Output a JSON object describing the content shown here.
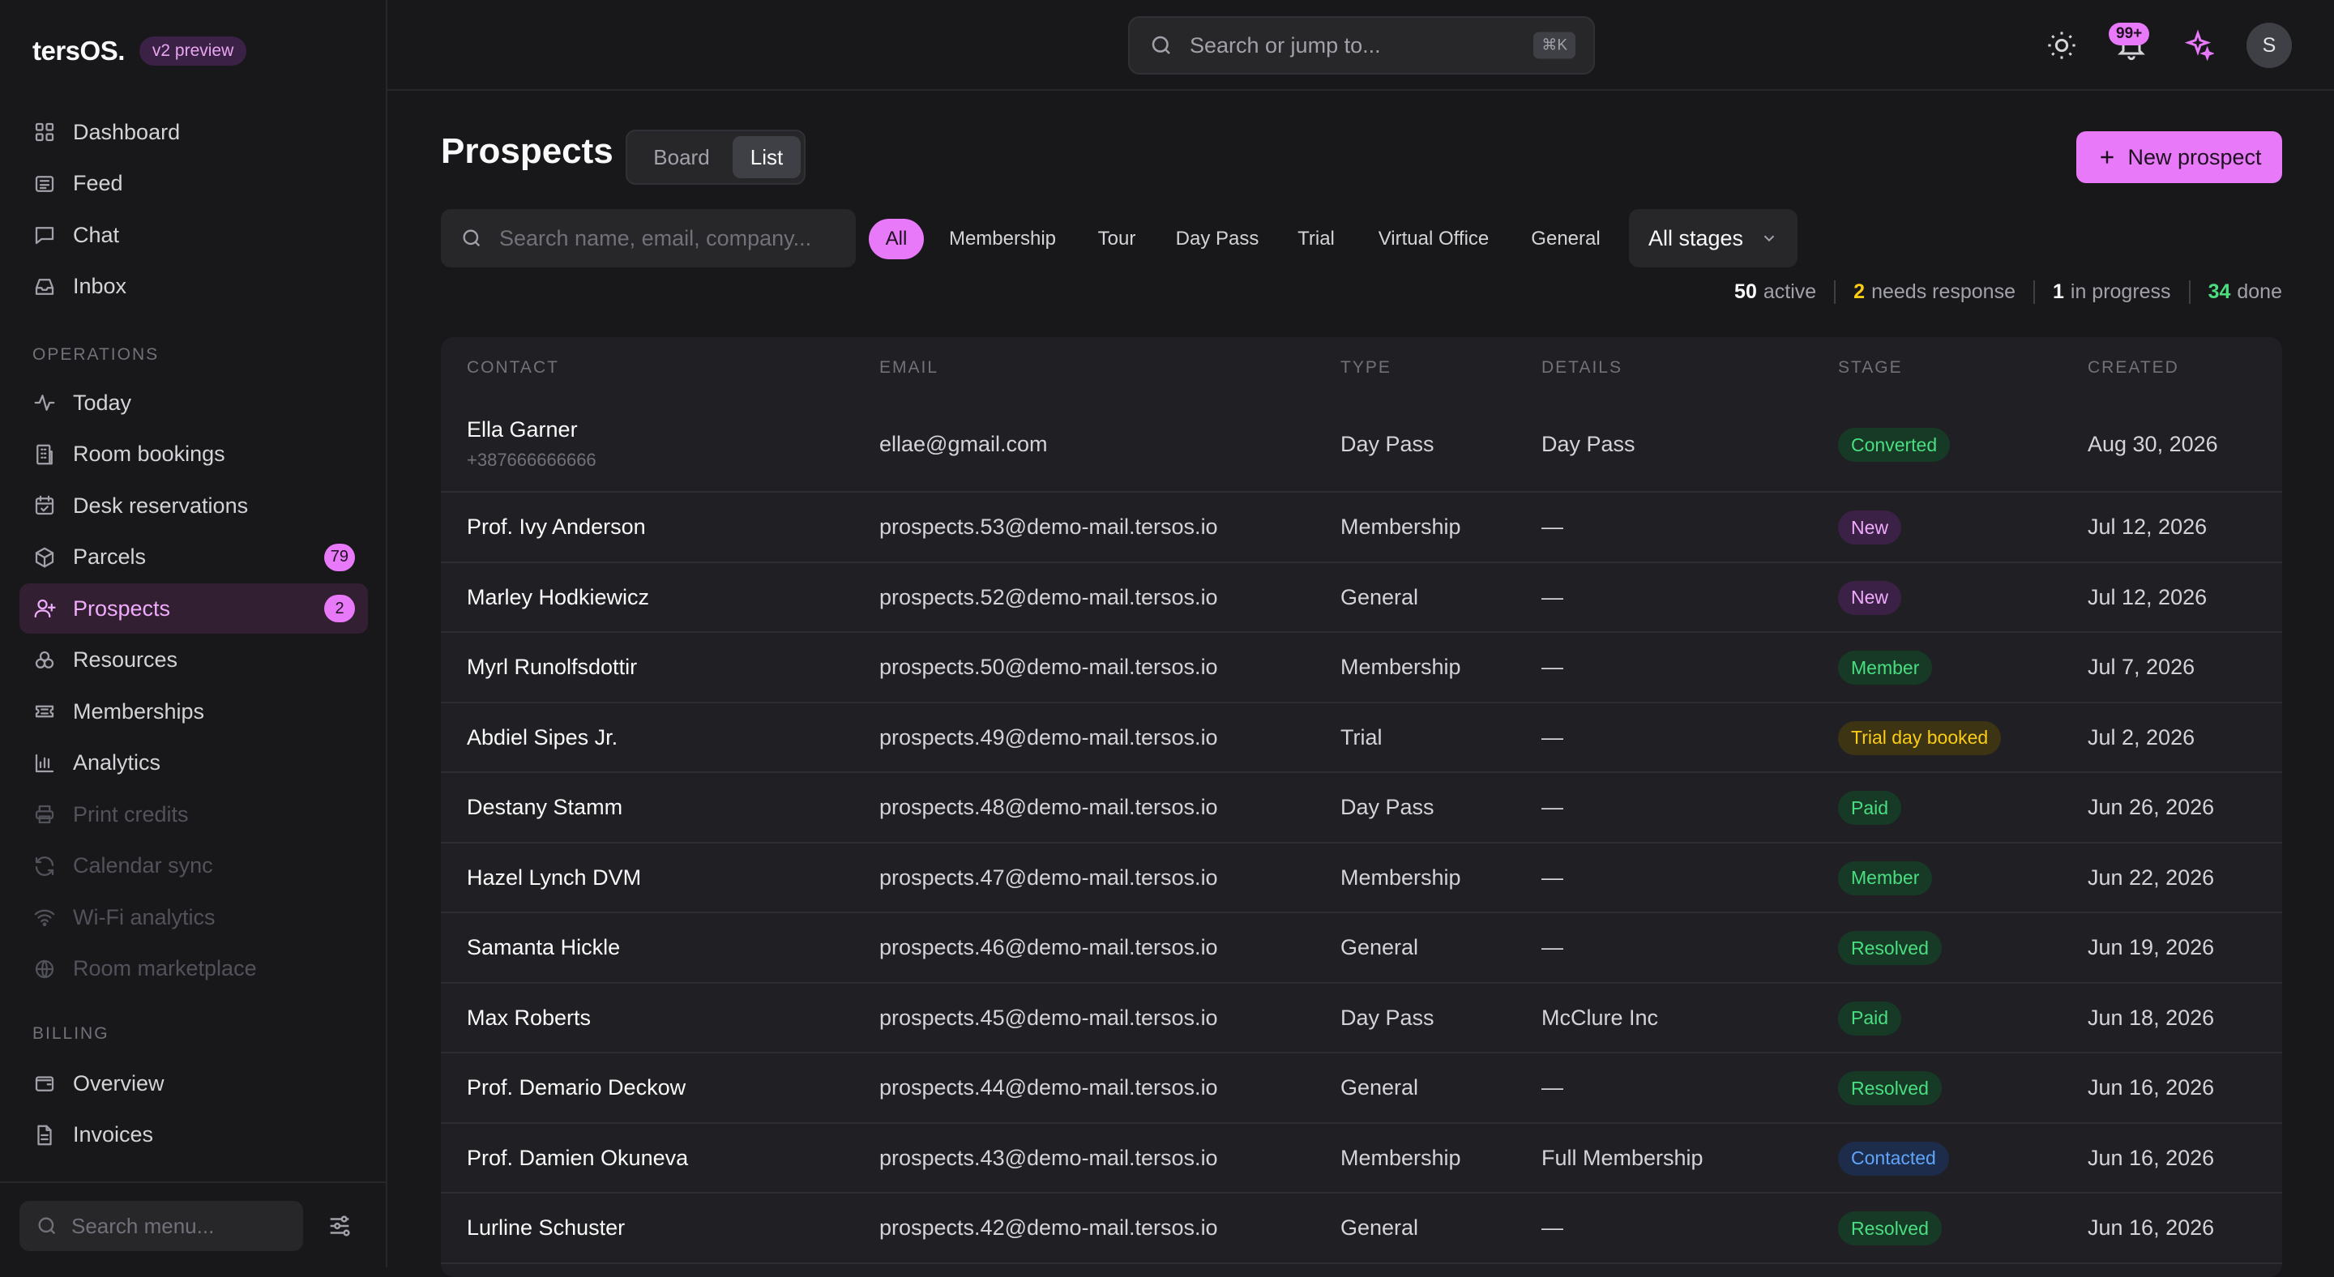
{
  "brand": {
    "name": "tersOS.",
    "badge": "v2 preview"
  },
  "colors": {
    "accent": "#e879f9",
    "background": "#18181b",
    "surface": "#27272a"
  },
  "sidebar": {
    "main": [
      {
        "label": "Dashboard",
        "icon": "grid-icon"
      },
      {
        "label": "Feed",
        "icon": "newspaper-icon"
      },
      {
        "label": "Chat",
        "icon": "chat-icon"
      },
      {
        "label": "Inbox",
        "icon": "inbox-icon"
      }
    ],
    "operations_label": "OPERATIONS",
    "operations": [
      {
        "label": "Today",
        "icon": "activity-icon"
      },
      {
        "label": "Room bookings",
        "icon": "building-icon"
      },
      {
        "label": "Desk reservations",
        "icon": "calendar-icon"
      },
      {
        "label": "Parcels",
        "icon": "package-icon",
        "count": "79"
      },
      {
        "label": "Prospects",
        "icon": "user-plus-icon",
        "count": "2",
        "active": true
      },
      {
        "label": "Resources",
        "icon": "boxes-icon"
      },
      {
        "label": "Memberships",
        "icon": "ticket-icon"
      },
      {
        "label": "Analytics",
        "icon": "bar-chart-icon"
      },
      {
        "label": "Print credits",
        "icon": "printer-icon",
        "disabled": true
      },
      {
        "label": "Calendar sync",
        "icon": "refresh-icon",
        "disabled": true
      },
      {
        "label": "Wi-Fi analytics",
        "icon": "wifi-icon",
        "disabled": true
      },
      {
        "label": "Room marketplace",
        "icon": "globe-icon",
        "disabled": true
      }
    ],
    "billing_label": "BILLING",
    "billing": [
      {
        "label": "Overview",
        "icon": "wallet-icon"
      },
      {
        "label": "Invoices",
        "icon": "file-icon"
      }
    ],
    "menu_search_placeholder": "Search menu..."
  },
  "topbar": {
    "search_placeholder": "Search or jump to...",
    "shortcut": "⌘K",
    "notifications_count": "99+",
    "avatar_initial": "S"
  },
  "page": {
    "title": "Prospects",
    "views": [
      "Board",
      "List"
    ],
    "selected_view": "List",
    "new_button": "New prospect",
    "search_placeholder": "Search name, email, company...",
    "type_filters": [
      "All",
      "Membership",
      "Tour",
      "Day Pass",
      "Trial",
      "Virtual Office",
      "General"
    ],
    "selected_filter": "All",
    "stage_select": "All stages",
    "stats": [
      {
        "value": "50",
        "label": "active",
        "color": "#fafafa"
      },
      {
        "value": "2",
        "label": "needs response",
        "color": "#facc15"
      },
      {
        "value": "1",
        "label": "in progress",
        "color": "#fafafa"
      },
      {
        "value": "34",
        "label": "done",
        "color": "#4ade80"
      }
    ]
  },
  "table": {
    "columns": [
      "CONTACT",
      "EMAIL",
      "TYPE",
      "DETAILS",
      "STAGE",
      "CREATED"
    ],
    "rows": [
      {
        "contact": "Ella Garner",
        "phone": "+387666666666",
        "email": "ellae@gmail.com",
        "type": "Day Pass",
        "details": "Day Pass",
        "stage": "Converted",
        "stage_tone": "green",
        "created": "Aug 30, 2026"
      },
      {
        "contact": "Prof. Ivy Anderson",
        "email": "prospects.53@demo-mail.tersos.io",
        "type": "Membership",
        "details": "—",
        "stage": "New",
        "stage_tone": "pink",
        "created": "Jul 12, 2026"
      },
      {
        "contact": "Marley Hodkiewicz",
        "email": "prospects.52@demo-mail.tersos.io",
        "type": "General",
        "details": "—",
        "stage": "New",
        "stage_tone": "pink",
        "created": "Jul 12, 2026"
      },
      {
        "contact": "Myrl Runolfsdottir",
        "email": "prospects.50@demo-mail.tersos.io",
        "type": "Membership",
        "details": "—",
        "stage": "Member",
        "stage_tone": "green",
        "created": "Jul 7, 2026"
      },
      {
        "contact": "Abdiel Sipes Jr.",
        "email": "prospects.49@demo-mail.tersos.io",
        "type": "Trial",
        "details": "—",
        "stage": "Trial day booked",
        "stage_tone": "yellow",
        "created": "Jul 2, 2026"
      },
      {
        "contact": "Destany Stamm",
        "email": "prospects.48@demo-mail.tersos.io",
        "type": "Day Pass",
        "details": "—",
        "stage": "Paid",
        "stage_tone": "green",
        "created": "Jun 26, 2026"
      },
      {
        "contact": "Hazel Lynch DVM",
        "email": "prospects.47@demo-mail.tersos.io",
        "type": "Membership",
        "details": "—",
        "stage": "Member",
        "stage_tone": "green",
        "created": "Jun 22, 2026"
      },
      {
        "contact": "Samanta Hickle",
        "email": "prospects.46@demo-mail.tersos.io",
        "type": "General",
        "details": "—",
        "stage": "Resolved",
        "stage_tone": "green",
        "created": "Jun 19, 2026"
      },
      {
        "contact": "Max Roberts",
        "email": "prospects.45@demo-mail.tersos.io",
        "type": "Day Pass",
        "details": "McClure Inc",
        "stage": "Paid",
        "stage_tone": "green",
        "created": "Jun 18, 2026"
      },
      {
        "contact": "Prof. Demario Deckow",
        "email": "prospects.44@demo-mail.tersos.io",
        "type": "General",
        "details": "—",
        "stage": "Resolved",
        "stage_tone": "green",
        "created": "Jun 16, 2026"
      },
      {
        "contact": "Prof. Damien Okuneva",
        "email": "prospects.43@demo-mail.tersos.io",
        "type": "Membership",
        "details": "Full Membership",
        "stage": "Contacted",
        "stage_tone": "blue",
        "created": "Jun 16, 2026"
      },
      {
        "contact": "Lurline Schuster",
        "email": "prospects.42@demo-mail.tersos.io",
        "type": "General",
        "details": "—",
        "stage": "Resolved",
        "stage_tone": "green",
        "created": "Jun 16, 2026"
      }
    ]
  }
}
